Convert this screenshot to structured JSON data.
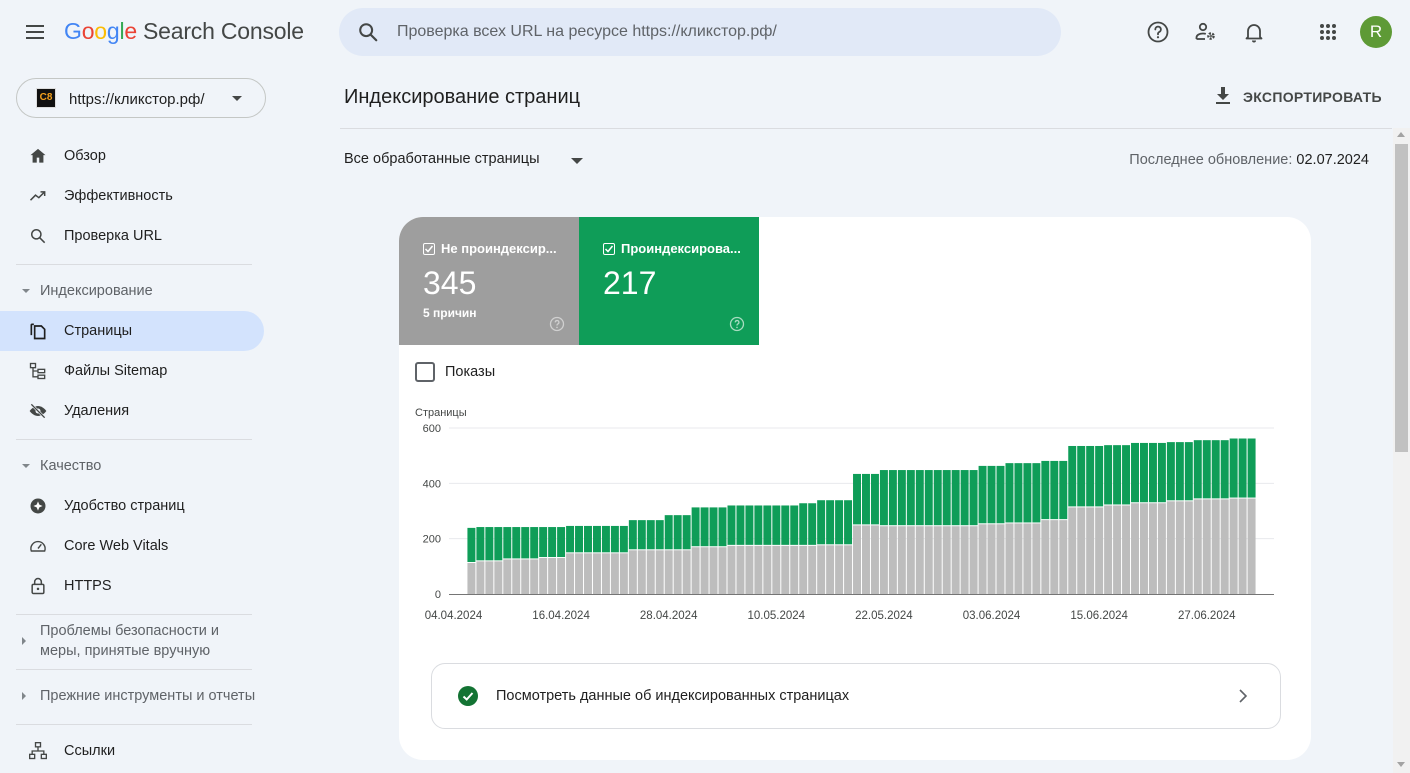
{
  "app": {
    "logo_google": [
      "G",
      "o",
      "o",
      "g",
      "l",
      "e"
    ],
    "logo_product": "Search Console"
  },
  "search": {
    "placeholder": "Проверка всех URL на ресурсе https://кликстор.рф/"
  },
  "topbar_icons": [
    "help-icon",
    "manage-users-icon",
    "notifications-icon",
    "apps-grid-icon"
  ],
  "user": {
    "avatar_letter": "R",
    "avatar_color": "#5e9a36"
  },
  "property": {
    "url": "https://кликстор.рф/",
    "favicon_text": "C8"
  },
  "sidebar": {
    "items_top": [
      {
        "label": "Обзор",
        "icon": "home-icon"
      },
      {
        "label": "Эффективность",
        "icon": "trending-up-icon"
      },
      {
        "label": "Проверка URL",
        "icon": "search-icon"
      }
    ],
    "sections": [
      {
        "label": "Индексирование",
        "expanded": true,
        "items": [
          {
            "label": "Страницы",
            "icon": "pages-icon",
            "active": true
          },
          {
            "label": "Файлы Sitemap",
            "icon": "sitemap-icon"
          },
          {
            "label": "Удаления",
            "icon": "removals-icon"
          }
        ]
      },
      {
        "label": "Качество",
        "expanded": true,
        "items": [
          {
            "label": "Удобство страниц",
            "icon": "page-experience-icon"
          },
          {
            "label": "Core Web Vitals",
            "icon": "speedometer-icon"
          },
          {
            "label": "HTTPS",
            "icon": "lock-icon"
          }
        ]
      },
      {
        "label": "Проблемы безопасности и меры, принятые вручную",
        "expanded": false
      },
      {
        "label": "Прежние инструменты и отчеты",
        "expanded": false
      }
    ],
    "items_bottom": [
      {
        "label": "Ссылки",
        "icon": "links-icon"
      }
    ]
  },
  "main": {
    "title": "Индексирование страниц",
    "export_label": "ЭКСПОРТИРОВАТЬ",
    "filter_label": "Все обработанные страницы",
    "last_update_label": "Последнее обновление:",
    "last_update_date": "02.07.2024",
    "tiles": [
      {
        "label": "Не проиндексир...",
        "value": "345",
        "sub": "5 причин",
        "checked": true,
        "color": "#9e9e9e"
      },
      {
        "label": "Проиндексирова...",
        "value": "217",
        "sub": "",
        "checked": true,
        "color": "#0f9d58"
      }
    ],
    "impressions_label": "Показы",
    "impressions_checked": false,
    "link_card_label": "Посмотреть данные об индексированных страницах"
  },
  "chart_data": {
    "type": "bar",
    "stacked": true,
    "ylabel": "Страницы",
    "ylim": [
      0,
      600
    ],
    "yticks": [
      0,
      200,
      400,
      600
    ],
    "grid": true,
    "xlim_days": [
      "04.04.2024",
      "05.07.2024"
    ],
    "x_tick_labels": [
      "04.04.2024",
      "16.04.2024",
      "28.04.2024",
      "10.05.2024",
      "22.05.2024",
      "03.06.2024",
      "15.06.2024",
      "27.06.2024"
    ],
    "start_date": "06.04.2024",
    "end_date": "02.07.2024",
    "series": [
      {
        "name": "Не проиндексированы",
        "color": "#bdbdbd",
        "values": [
          112,
          118,
          118,
          118,
          125,
          125,
          125,
          125,
          130,
          130,
          130,
          147,
          147,
          147,
          147,
          147,
          147,
          147,
          158,
          158,
          158,
          158,
          158,
          158,
          158,
          169,
          169,
          169,
          169,
          174,
          174,
          174,
          174,
          174,
          174,
          174,
          174,
          174,
          174,
          176,
          176,
          176,
          176,
          248,
          248,
          248,
          245,
          245,
          245,
          245,
          245,
          245,
          245,
          245,
          245,
          245,
          245,
          252,
          252,
          252,
          255,
          255,
          255,
          255,
          267,
          267,
          267,
          313,
          313,
          313,
          313,
          320,
          320,
          320,
          328,
          328,
          328,
          328,
          335,
          335,
          335,
          342,
          342,
          342,
          342,
          345,
          345,
          345
        ]
      },
      {
        "name": "Проиндексированы",
        "color": "#0f9d58",
        "values": [
          127,
          124,
          124,
          124,
          117,
          117,
          117,
          117,
          112,
          112,
          112,
          99,
          99,
          99,
          99,
          99,
          99,
          99,
          109,
          109,
          109,
          109,
          127,
          127,
          127,
          144,
          144,
          144,
          144,
          146,
          146,
          146,
          146,
          146,
          146,
          146,
          146,
          154,
          154,
          163,
          163,
          163,
          163,
          186,
          186,
          186,
          203,
          203,
          203,
          203,
          203,
          203,
          203,
          203,
          203,
          203,
          203,
          211,
          211,
          211,
          218,
          218,
          218,
          218,
          214,
          214,
          214,
          222,
          222,
          222,
          222,
          218,
          218,
          218,
          218,
          218,
          218,
          218,
          214,
          214,
          214,
          214,
          214,
          214,
          214,
          217,
          217,
          217
        ]
      }
    ]
  }
}
